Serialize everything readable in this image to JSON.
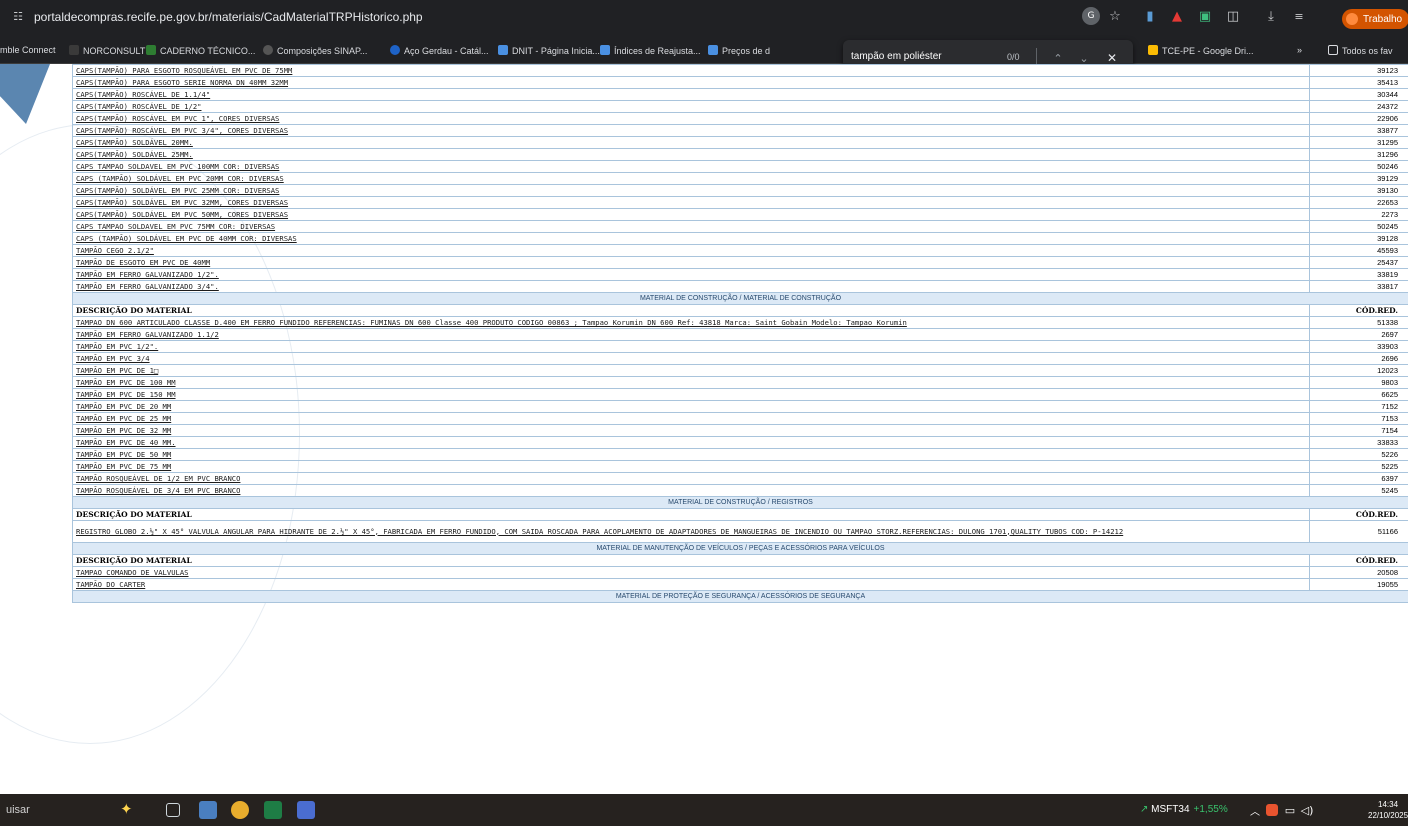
{
  "browser": {
    "url": "portaldecompras.recife.pe.gov.br/materiais/CadMaterialTRPHistorico.php",
    "profile_label": "Trabalho",
    "bookmarks": [
      "mble Connect",
      "NORCONSULT",
      "CADERNO TÉCNICO...",
      "Composições SINAP...",
      "Aço Gerdau - Catál...",
      "DNIT - Página Inicia...",
      "Índices de Reajusta...",
      "Preços de d",
      "TCE-PE - Google Dri...",
      "»",
      "Todos os fav"
    ],
    "find": {
      "query": "tampão em poliéster",
      "count": "0/0"
    }
  },
  "table": {
    "rows": [
      {
        "type": "item",
        "desc": "CAPS(TAMPÃO) PARA ESGOTO ROSQUEÁVEL EM PVC DE 75MM",
        "code": "39123"
      },
      {
        "type": "item",
        "desc": "CAPS(TAMPÃO) PARA ESGOTO SERIE NORMA DN 40MM 32MM",
        "code": "35413"
      },
      {
        "type": "item",
        "desc": "CAPS(TAMPÃO) ROSCÁVEL DE 1.1/4\"",
        "code": "30344"
      },
      {
        "type": "item",
        "desc": "CAPS(TAMPÃO) ROSCÁVEL DE 1/2\"",
        "code": "24372"
      },
      {
        "type": "item",
        "desc": "CAPS(TAMPÃO) ROSCÁVEL EM PVC 1\", CORES DIVERSAS",
        "code": "22906"
      },
      {
        "type": "item",
        "desc": "CAPS(TAMPÃO) ROSCÁVEL EM PVC 3/4\", CORES DIVERSAS",
        "code": "33877"
      },
      {
        "type": "item",
        "desc": "CAPS(TAMPÃO) SOLDÁVEL 20MM.",
        "code": "31295"
      },
      {
        "type": "item",
        "desc": "CAPS(TAMPÃO) SOLDÁVEL 25MM.",
        "code": "31296"
      },
      {
        "type": "item",
        "desc": "CAPS TAMPAO SOLDAVEL EM PVC 100MM COR: DIVERSAS",
        "code": "50246"
      },
      {
        "type": "item",
        "desc": "CAPS (TAMPÃO) SOLDÁVEL EM PVC 20MM COR: DIVERSAS",
        "code": "39129"
      },
      {
        "type": "item",
        "desc": "CAPS(TAMPÃO) SOLDÁVEL EM PVC 25MM COR: DIVERSAS",
        "code": "39130"
      },
      {
        "type": "item",
        "desc": "CAPS(TAMPÃO) SOLDÁVEL EM PVC 32MM, CORES DIVERSAS",
        "code": "22653"
      },
      {
        "type": "item",
        "desc": "CAPS(TAMPÃO) SOLDÁVEL EM PVC 50MM, CORES DIVERSAS",
        "code": "2273"
      },
      {
        "type": "item",
        "desc": "CAPS TAMPAO SOLDAVEL EM PVC 75MM COR: DIVERSAS",
        "code": "50245"
      },
      {
        "type": "item",
        "desc": "CAPS (TAMPÃO) SOLDÁVEL EM PVC DE 40MM COR: DIVERSAS",
        "code": "39128"
      },
      {
        "type": "item",
        "desc": "TAMPÃO CEGO 2.1/2\"",
        "code": "45593"
      },
      {
        "type": "item",
        "desc": "TAMPÃO DE ESGOTO EM PVC DE 40MM",
        "code": "25437"
      },
      {
        "type": "item",
        "desc": "TAMPÃO EM FERRO GALVANIZADO 1/2\".",
        "code": "33819"
      },
      {
        "type": "item",
        "desc": "TAMPÃO EM FERRO GALVANIZADO 3/4\".",
        "code": "33817"
      },
      {
        "type": "section",
        "text": "MATERIAL DE CONSTRUÇÃO / MATERIAL DE CONSTRUÇÃO"
      },
      {
        "type": "header",
        "desc": "DESCRIÇÃO DO MATERIAL",
        "code": "CÓD.RED."
      },
      {
        "type": "item",
        "desc": "TAMPAO DN 600 ARTICULADO CLASSE D.400 EM FERRO FUNDIDO REFERENCIAS: FUMINAS DN 600 Classe 400 PRODUTO CODIGO 00863 ; Tampao Korumin DN 600 Ref: 43818 Marca: Saint Gobain Modelo: Tampao Korumin",
        "code": "51338"
      },
      {
        "type": "item",
        "desc": "TAMPÃO EM FERRO GALVANIZADO 1.1/2",
        "code": "2697"
      },
      {
        "type": "item",
        "desc": "TAMPÃO EM PVC 1/2\".",
        "code": "33903"
      },
      {
        "type": "item",
        "desc": "TAMPÃO EM PVC 3/4",
        "code": "2696"
      },
      {
        "type": "item",
        "desc": "TAMPÃO EM PVC DE 1□",
        "code": "12023"
      },
      {
        "type": "item",
        "desc": "TAMPÃO EM PVC DE 100 MM",
        "code": "9803"
      },
      {
        "type": "item",
        "desc": "TAMPÃO EM PVC DE 150 MM",
        "code": "6625"
      },
      {
        "type": "item",
        "desc": "TAMPÃO EM PVC DE 20 MM",
        "code": "7152"
      },
      {
        "type": "item",
        "desc": "TAMPÃO EM PVC DE 25 MM",
        "code": "7153"
      },
      {
        "type": "item",
        "desc": "TAMPÃO EM PVC DE 32 MM",
        "code": "7154"
      },
      {
        "type": "item",
        "desc": "TAMPÃO EM PVC DE 40 MM.",
        "code": "33833"
      },
      {
        "type": "item",
        "desc": "TAMPÃO EM PVC DE 50 MM",
        "code": "5226"
      },
      {
        "type": "item",
        "desc": "TAMPÃO EM PVC DE 75 MM",
        "code": "5225"
      },
      {
        "type": "item",
        "desc": "TAMPÃO ROSQUEÁVEL DE 1/2 EM PVC BRANCO",
        "code": "6397"
      },
      {
        "type": "item",
        "desc": "TAMPÃO ROSQUEÁVEL DE 3/4 EM PVC BRANCO",
        "code": "5245"
      },
      {
        "type": "section",
        "text": "MATERIAL DE CONSTRUÇÃO / REGISTROS"
      },
      {
        "type": "header",
        "desc": "DESCRIÇÃO DO MATERIAL",
        "code": "CÓD.RED."
      },
      {
        "type": "item",
        "tall": true,
        "desc": "REGISTRO GLOBO 2.½\" X 45° VALVULA ANGULAR PARA HIDRANTE DE 2.½\" X 45°, FABRICADA EM FERRO FUNDIDO, COM SAIDA ROSCADA PARA ACOPLAMENTO DE ADAPTADORES DE MANGUEIRAS DE INCENDIO OU TAMPAO STORZ.REFERENCIAS: DULONG 1701,QUALITY TUBOS COD: P-14212",
        "code": "51166"
      },
      {
        "type": "section",
        "text": "MATERIAL DE MANUTENÇÃO DE VEÍCULOS / PEÇAS E ACESSÓRIOS PARA VEÍCULOS"
      },
      {
        "type": "header",
        "desc": "DESCRIÇÃO DO MATERIAL",
        "code": "CÓD.RED."
      },
      {
        "type": "item",
        "desc": "TAMPAO COMANDO DE VALVULAS",
        "code": "20508"
      },
      {
        "type": "item",
        "desc": "TAMPÃO DO CARTER",
        "code": "19055"
      },
      {
        "type": "section",
        "text": "MATERIAL DE PROTEÇÃO E SEGURANÇA / ACESSÓRIOS DE SEGURANÇA"
      }
    ]
  },
  "taskbar": {
    "search_text": "uisar",
    "stock_name": "MSFT34",
    "stock_change": "+1,55%",
    "time": "14:34",
    "date": "22/10/2025"
  },
  "colors": {
    "section_bg": "#dce9f6",
    "cell_border": "#a9c4dc",
    "chrome_bg": "#202124",
    "taskbar_bg": "#26221f"
  }
}
